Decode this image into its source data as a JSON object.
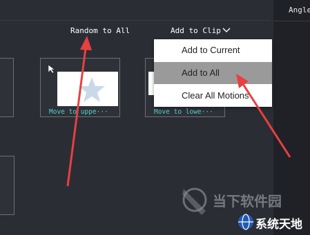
{
  "panel": {
    "angle_label": "Angle"
  },
  "toolbar": {
    "random_label": "Random to All",
    "add_to_clip_label": "Add to Clip"
  },
  "thumbnails": [
    {
      "caption": "Move to uppe···"
    },
    {
      "caption": "Move to lowe···"
    }
  ],
  "menu": {
    "items": [
      {
        "label": "Add to Current"
      },
      {
        "label": "Add to All",
        "highlighted": true
      },
      {
        "label": "Clear All Motions"
      }
    ]
  },
  "watermark": {
    "brand_cn": "当下软件园",
    "site_cn": "系统天地"
  },
  "colors": {
    "background": "#2b2d35",
    "caption": "#4fd3cf",
    "arrow": "#e84040",
    "menu_highlight": "#9a9a9a"
  }
}
